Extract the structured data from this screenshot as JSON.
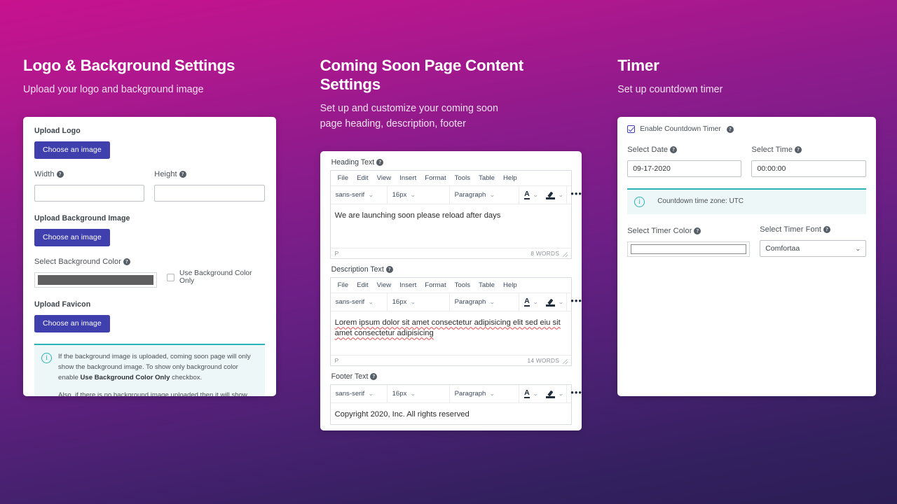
{
  "theme": {
    "gradient_top": "#c8128e",
    "gradient_bottom": "#2b1d55",
    "button_color": "#3f3fae",
    "notice_accent": "#2bb4b8",
    "notice_bg": "#eef7f8",
    "swatch_color": "#5f5f5f"
  },
  "panels": [
    {
      "title": "Logo & Background Settings",
      "subtitle": "Upload your logo and background image"
    },
    {
      "title": "Coming Soon Page Content Settings",
      "subtitle_line1": "Set up and customize your coming soon",
      "subtitle_line2": "page heading, description, footer"
    },
    {
      "title": "Timer",
      "subtitle": "Set up countdown timer"
    }
  ],
  "logo_panel": {
    "upload_logo_label": "Upload Logo",
    "choose_logo_button": "Choose an image",
    "width_label": "Width",
    "width_value": "",
    "height_label": "Height",
    "height_value": "",
    "upload_background_label": "Upload Background Image",
    "choose_background_button": "Choose an image",
    "select_background_color_label": "Select Background Color",
    "background_color_value": "#5f5f5f",
    "use_background_color_only_label": "Use Background Color Only",
    "use_background_color_only_checked": false,
    "upload_favicon_label": "Upload Favicon",
    "choose_favicon_button": "Choose an image",
    "notice": {
      "icon": "info-icon",
      "paragraph1_part1": "If the background image is uploaded, coming soon page will only show the background image. To show only background color enable ",
      "paragraph1_bold": "Use Background Color Only",
      "paragraph1_part2": " checkbox.",
      "paragraph2": "Also, if there is no background image uploaded then it will show the selected background color."
    }
  },
  "content_panel": {
    "editors": [
      {
        "label": "Heading Text",
        "menu": [
          "File",
          "Edit",
          "View",
          "Insert",
          "Format",
          "Tools",
          "Table",
          "Help"
        ],
        "font_family": "sans-serif",
        "font_size": "16px",
        "block_format": "Paragraph",
        "body": "We are launching soon please reload after days",
        "status_path": "P",
        "word_count": "8 WORDS"
      },
      {
        "label": "Description Text",
        "menu": [
          "File",
          "Edit",
          "View",
          "Insert",
          "Format",
          "Tools",
          "Table",
          "Help"
        ],
        "font_family": "sans-serif",
        "font_size": "16px",
        "block_format": "Paragraph",
        "body": "Lorem ipsum dolor sit amet consectetur adipisicing elit sed eiu sit amet consectetur adipisicing",
        "status_path": "P",
        "word_count": "14 WORDS"
      },
      {
        "label": "Footer Text",
        "font_family": "sans-serif",
        "font_size": "16px",
        "block_format": "Paragraph",
        "body": "Copyright 2020, Inc. All rights reserved"
      }
    ]
  },
  "timer_panel": {
    "enable_label": "Enable Countdown Timer",
    "enable_checked": true,
    "select_date_label": "Select Date",
    "select_date_value": "09-17-2020",
    "select_time_label": "Select Time",
    "select_time_value": "00:00:00",
    "notice_text": "Countdown time zone: UTC",
    "select_timer_color_label": "Select Timer Color",
    "timer_color_value": "",
    "select_timer_font_label": "Select Timer Font",
    "timer_font_value": "Comfortaa"
  }
}
